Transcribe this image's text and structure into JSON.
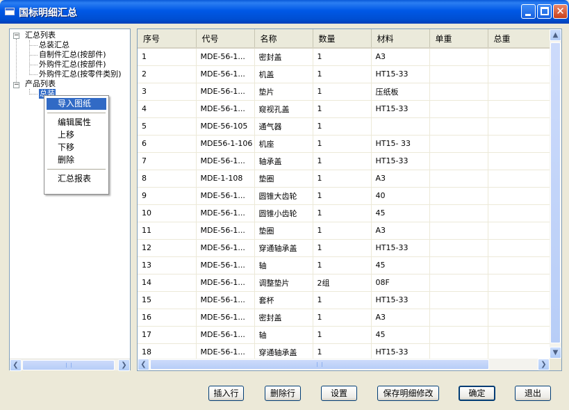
{
  "window": {
    "title": "国标明细汇总"
  },
  "tree": {
    "nodes": [
      {
        "label": "汇总列表",
        "level": 0,
        "expander": "−"
      },
      {
        "label": "总装汇总",
        "level": 1
      },
      {
        "label": "自制件汇总(按部件)",
        "level": 1
      },
      {
        "label": "外购件汇总(按部件)",
        "level": 1
      },
      {
        "label": "外购件汇总(按零件类别)",
        "level": 1
      },
      {
        "label": "产品列表",
        "level": 0,
        "expander": "−"
      },
      {
        "label": "总装",
        "level": 1
      }
    ]
  },
  "context_menu": {
    "items": [
      "导入图纸",
      "编辑属性",
      "上移",
      "下移",
      "删除",
      "汇总报表"
    ],
    "selected": "导入图纸"
  },
  "grid": {
    "columns": [
      "序号",
      "代号",
      "名称",
      "数量",
      "材料",
      "单重",
      "总重"
    ],
    "rows": [
      [
        "1",
        "MDE-56-1...",
        "密封盖",
        "1",
        "A3",
        "",
        ""
      ],
      [
        "2",
        "MDE-56-1...",
        "机盖",
        "1",
        "HT15-33",
        "",
        ""
      ],
      [
        "3",
        "MDE-56-1...",
        "垫片",
        "1",
        "压纸板",
        "",
        ""
      ],
      [
        "4",
        "MDE-56-1...",
        "窥视孔盖",
        "1",
        "HT15-33",
        "",
        ""
      ],
      [
        "5",
        "MDE-56-105",
        "通气器",
        "1",
        "",
        "",
        ""
      ],
      [
        "6",
        "MDE56-1-106",
        "机座",
        "1",
        "HT15- 33",
        "",
        ""
      ],
      [
        "7",
        "MDE-56-1...",
        "轴承盖",
        "1",
        "HT15-33",
        "",
        ""
      ],
      [
        "8",
        "MDE-1-108",
        "垫圈",
        "1",
        "A3",
        "",
        ""
      ],
      [
        "9",
        "MDE-56-1...",
        "圆锥大齿轮",
        "1",
        "40",
        "",
        ""
      ],
      [
        "10",
        "MDE-56-1...",
        "圆锥小齿轮",
        "1",
        "45",
        "",
        ""
      ],
      [
        "11",
        "MDE-56-1...",
        "垫圈",
        "1",
        "A3",
        "",
        ""
      ],
      [
        "12",
        "MDE-56-1...",
        "穿通轴承盖",
        "1",
        "HT15-33",
        "",
        ""
      ],
      [
        "13",
        "MDE-56-1...",
        "轴",
        "1",
        "45",
        "",
        ""
      ],
      [
        "14",
        "MDE-56-1...",
        "调整垫片",
        "2组",
        "08F",
        "",
        ""
      ],
      [
        "15",
        "MDE-56-1...",
        "套杯",
        "1",
        "HT15-33",
        "",
        ""
      ],
      [
        "16",
        "MDE-56-1...",
        "密封盖",
        "1",
        "A3",
        "",
        ""
      ],
      [
        "17",
        "MDE-56-1...",
        "轴",
        "1",
        "45",
        "",
        ""
      ],
      [
        "18",
        "MDE-56-1...",
        "穿通轴承盖",
        "1",
        "HT15-33",
        "",
        ""
      ]
    ]
  },
  "buttons": {
    "insert_row": "插入行",
    "delete_row": "删除行",
    "settings": "设置",
    "save_changes": "保存明细修改",
    "ok": "确定",
    "exit": "退出"
  }
}
